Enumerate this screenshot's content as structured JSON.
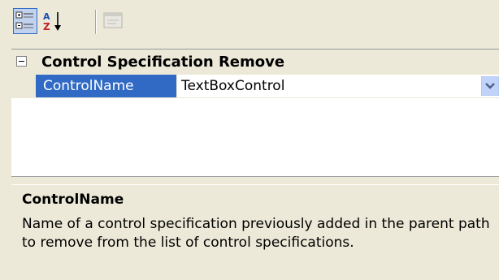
{
  "toolbar": {
    "categorized_icon": "categorized-view-icon",
    "alphabetical_icon": "sort-alphabetical-icon",
    "property_pages_icon": "property-pages-icon"
  },
  "grid": {
    "category": {
      "label": "Control Specification Remove",
      "expanded": true
    },
    "properties": [
      {
        "name": "ControlName",
        "value": "TextBoxControl",
        "selected": true
      }
    ]
  },
  "help": {
    "title": "ControlName",
    "description": "Name of a control specification previously added in the parent path to remove from the list of control specifications."
  },
  "colors": {
    "selection": "#316ac5",
    "panel": "#ece9d8",
    "grid_bg": "#ffffff"
  }
}
